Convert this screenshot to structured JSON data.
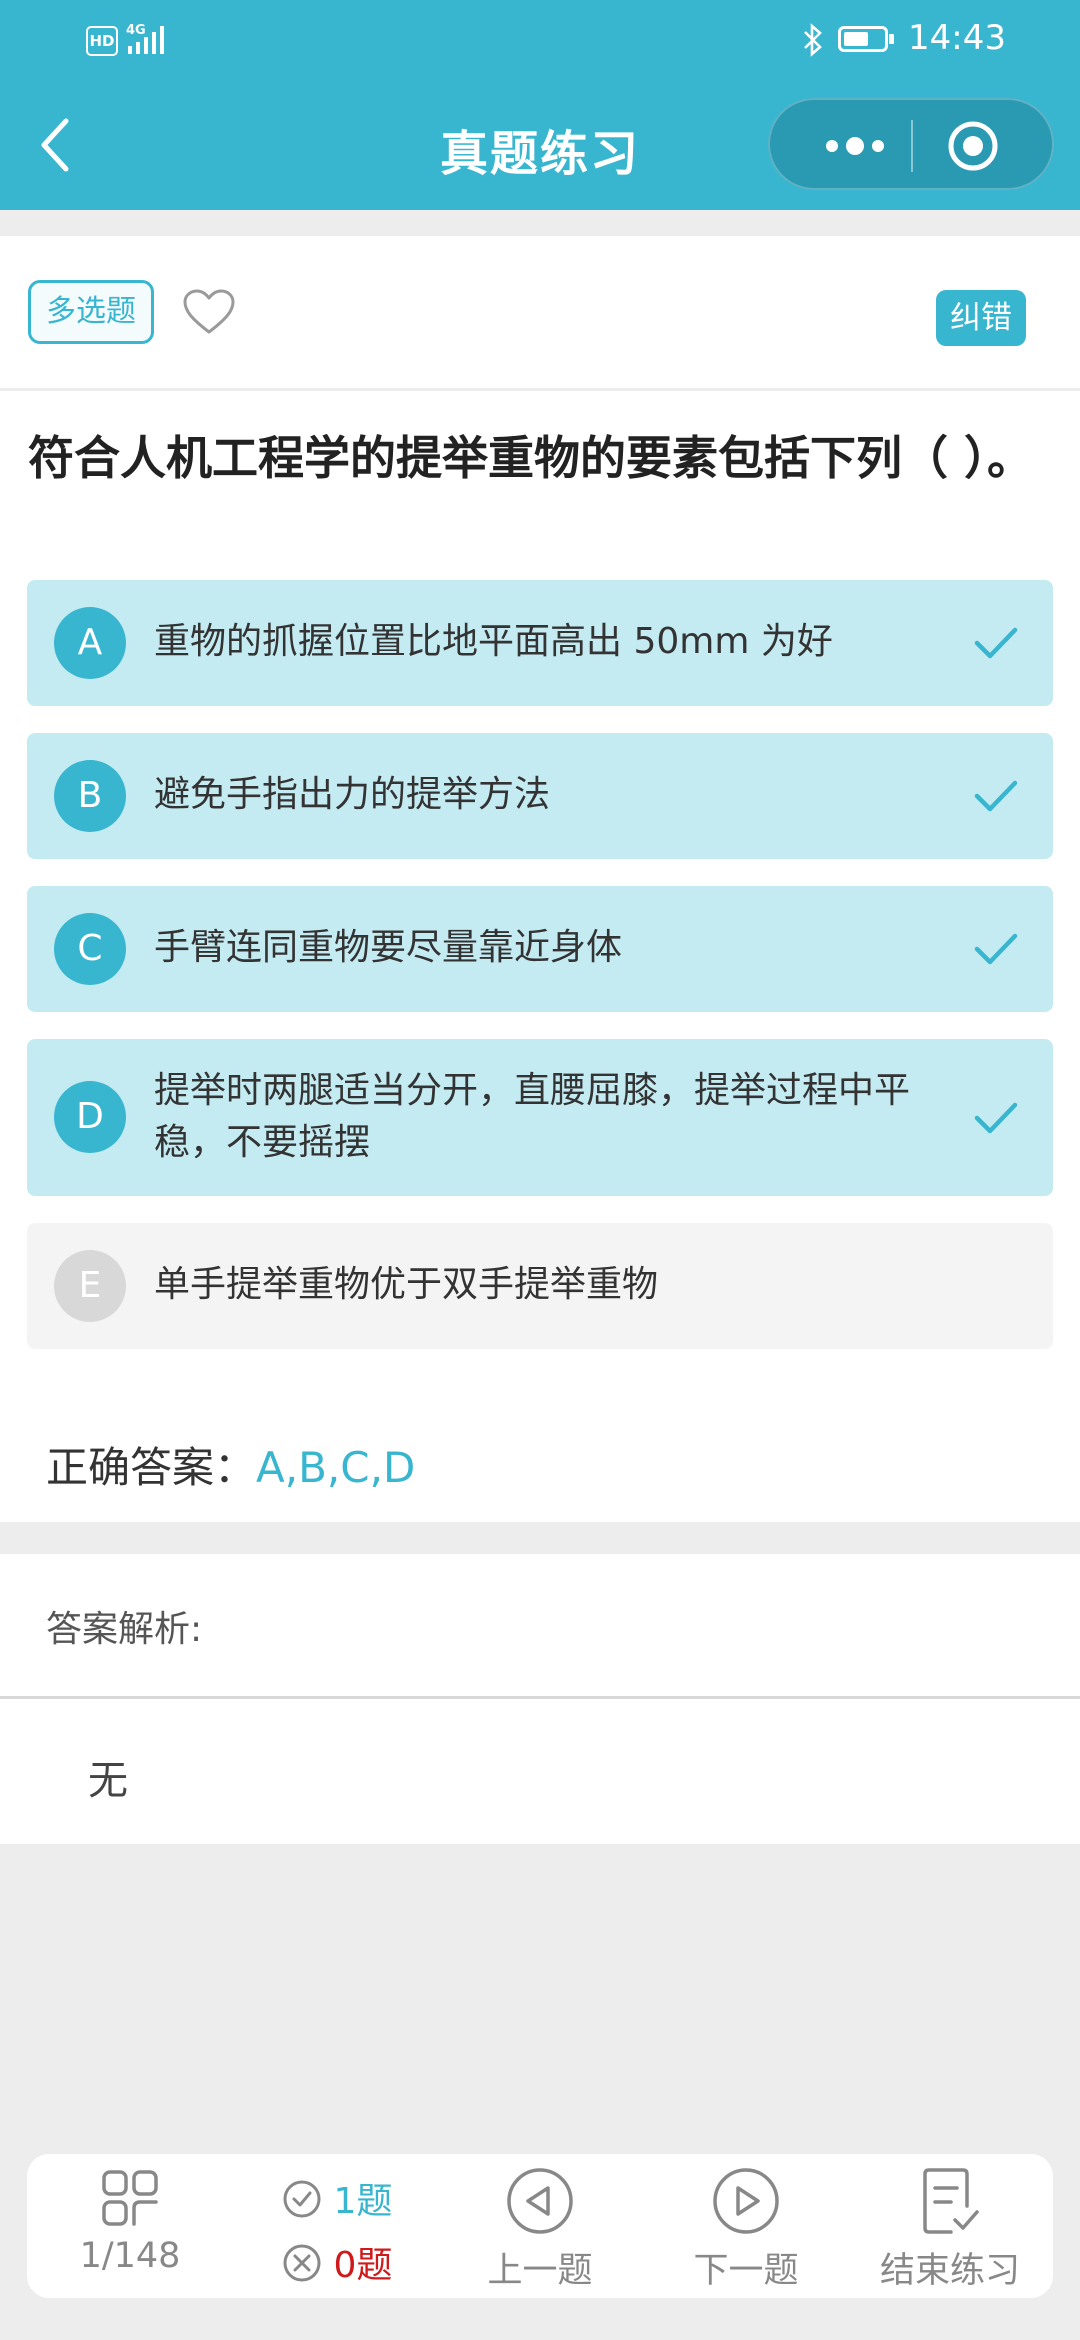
{
  "status_bar": {
    "hd": "HD",
    "network": "4G",
    "time": "14:43"
  },
  "header": {
    "title": "真题练习",
    "icons": [
      "back-chevron-icon",
      "more-dots-icon",
      "target-circle-icon"
    ]
  },
  "question_meta": {
    "type_tag": "多选题",
    "correct_button": "纠错"
  },
  "question": {
    "text": "符合人机工程学的提举重物的要素包括下列（ ）。"
  },
  "options": [
    {
      "letter": "A",
      "text": "重物的抓握位置比地平面高出 50mm 为好",
      "selected": true
    },
    {
      "letter": "B",
      "text": "避免手指出力的提举方法",
      "selected": true
    },
    {
      "letter": "C",
      "text": "手臂连同重物要尽量靠近身体",
      "selected": true
    },
    {
      "letter": "D",
      "text": "提举时两腿适当分开，直腰屈膝，提举过程中平稳，不要摇摆",
      "selected": true
    },
    {
      "letter": "E",
      "text": "单手提举重物优于双手提举重物",
      "selected": false
    }
  ],
  "answer": {
    "label": "正确答案：",
    "value": "A,B,C,D"
  },
  "analysis": {
    "label": "答案解析:",
    "text": "无"
  },
  "bottom_bar": {
    "progress": "1/148",
    "correct_count": "1题",
    "wrong_count": "0题",
    "prev_label": "上一题",
    "next_label": "下一题",
    "end_label": "结束练习"
  },
  "colors": {
    "accent": "#38b5cf",
    "selected_bg": "#c4ebf2",
    "error_red": "#d0191b"
  }
}
